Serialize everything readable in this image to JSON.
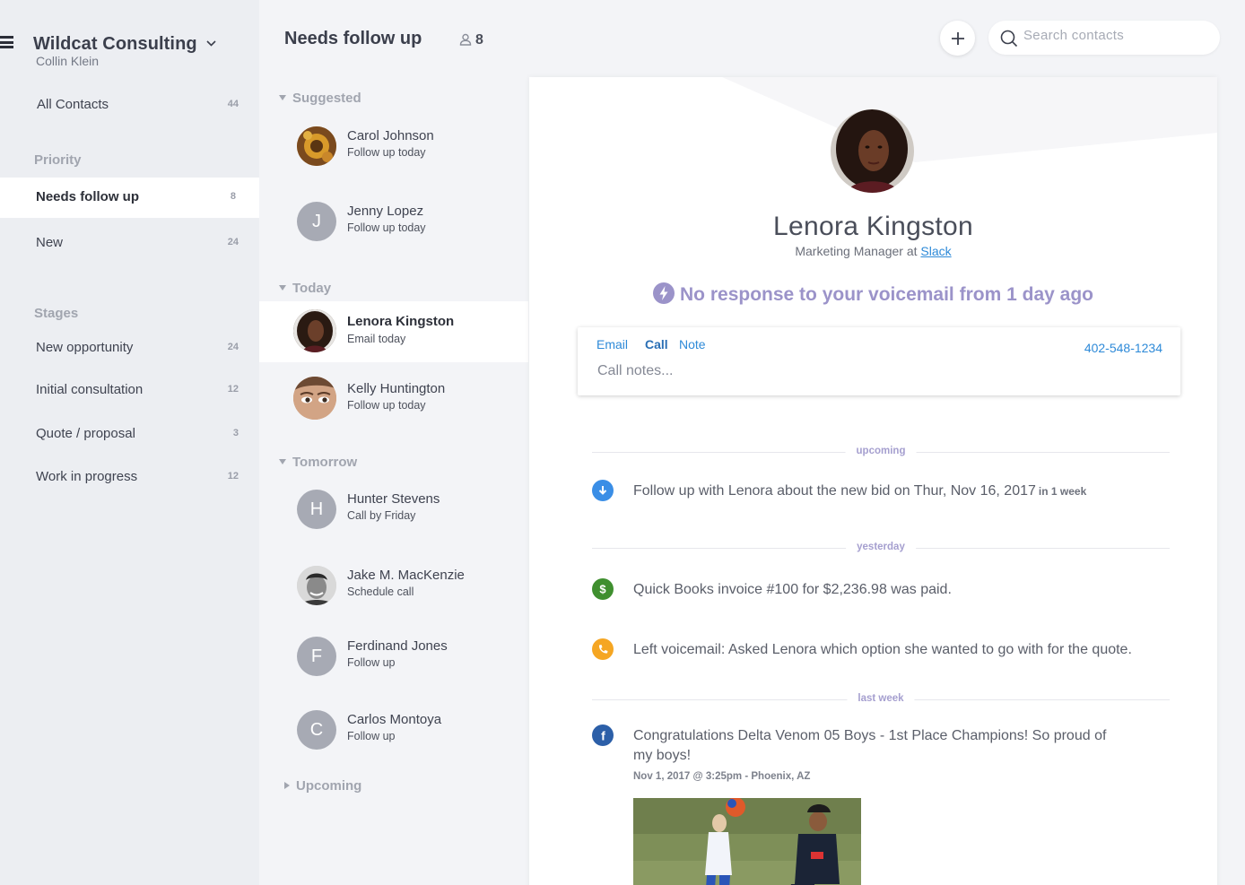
{
  "sidebar": {
    "org_name": "Wildcat Consulting",
    "user_name": "Collin Klein",
    "all_contacts": {
      "label": "All Contacts",
      "count": "44"
    },
    "priority_heading": "Priority",
    "priority_items": [
      {
        "label": "Needs follow up",
        "count": "8"
      },
      {
        "label": "New",
        "count": "24"
      }
    ],
    "stages_heading": "Stages",
    "stage_items": [
      {
        "label": "New opportunity",
        "count": "24"
      },
      {
        "label": "Initial consultation",
        "count": "12"
      },
      {
        "label": "Quote / proposal",
        "count": "3"
      },
      {
        "label": "Work in progress",
        "count": "12"
      }
    ]
  },
  "header": {
    "title": "Needs follow up",
    "count": "8",
    "search_placeholder": "Search contacts"
  },
  "contact_list": {
    "sections": [
      {
        "label": "Suggested"
      },
      {
        "label": "Today"
      },
      {
        "label": "Tomorrow"
      },
      {
        "label": "Upcoming"
      }
    ],
    "contacts": [
      {
        "name": "Carol Johnson",
        "status": "Follow up today",
        "initial": ""
      },
      {
        "name": "Jenny Lopez",
        "status": "Follow up today",
        "initial": "J"
      },
      {
        "name": "Lenora Kingston",
        "status": "Email today",
        "initial": ""
      },
      {
        "name": "Kelly Huntington",
        "status": "Follow up today",
        "initial": ""
      },
      {
        "name": "Hunter Stevens",
        "status": "Call by Friday",
        "initial": "H"
      },
      {
        "name": "Jake M. MacKenzie",
        "status": "Schedule call",
        "initial": ""
      },
      {
        "name": "Ferdinand Jones",
        "status": "Follow up",
        "initial": "F"
      },
      {
        "name": "Carlos Montoya",
        "status": "Follow up",
        "initial": "C"
      }
    ]
  },
  "profile": {
    "name": "Lenora Kingston",
    "role_prefix": "Marketing Manager at",
    "company": "Slack",
    "alert": "No response to your voicemail from 1 day ago"
  },
  "compose": {
    "tabs": [
      "Email",
      "Call",
      "Note"
    ],
    "active_tab": "Call",
    "phone": "402-548-1234",
    "placeholder": "Call notes..."
  },
  "timeline": {
    "dividers": [
      "upcoming",
      "yesterday",
      "last week"
    ],
    "events": [
      {
        "icon": "follow-up-icon",
        "color": "#3a8ee6",
        "text": "Follow up with Lenora about the new bid  on Thur, Nov 16, 2017",
        "relative": "in 1 week"
      },
      {
        "icon": "dollar-icon",
        "color": "#3f8f2f",
        "text": "Quick Books invoice #100 for $2,236.98 was paid.",
        "relative": ""
      },
      {
        "icon": "phone-icon",
        "color": "#f5a623",
        "text": "Left voicemail: Asked Lenora which option she wanted to go with for the quote.",
        "relative": ""
      },
      {
        "icon": "facebook-icon",
        "color": "#2c5fa8",
        "text_line1": "Congratulations Delta Venom 05 Boys - 1st Place Champions! So proud of",
        "text_line2": "my boys!",
        "meta": "Nov 1, 2017 @ 3:25pm  - Phoenix, AZ"
      }
    ]
  },
  "colors": {
    "accent_blue": "#2e8ad8",
    "alert_purple": "#9b93c9",
    "sidebar_bg": "#eceef2",
    "page_bg": "#f3f4f7"
  }
}
